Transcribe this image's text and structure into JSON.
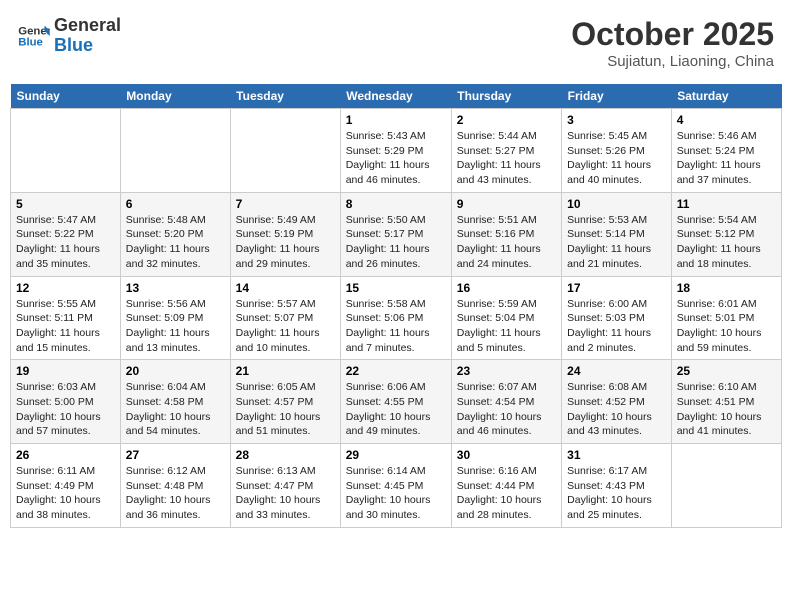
{
  "header": {
    "logo_general": "General",
    "logo_blue": "Blue",
    "month_title": "October 2025",
    "location": "Sujiatun, Liaoning, China"
  },
  "weekdays": [
    "Sunday",
    "Monday",
    "Tuesday",
    "Wednesday",
    "Thursday",
    "Friday",
    "Saturday"
  ],
  "days": [
    {
      "num": "",
      "info": ""
    },
    {
      "num": "",
      "info": ""
    },
    {
      "num": "",
      "info": ""
    },
    {
      "num": "1",
      "info": "Sunrise: 5:43 AM\nSunset: 5:29 PM\nDaylight: 11 hours and 46 minutes."
    },
    {
      "num": "2",
      "info": "Sunrise: 5:44 AM\nSunset: 5:27 PM\nDaylight: 11 hours and 43 minutes."
    },
    {
      "num": "3",
      "info": "Sunrise: 5:45 AM\nSunset: 5:26 PM\nDaylight: 11 hours and 40 minutes."
    },
    {
      "num": "4",
      "info": "Sunrise: 5:46 AM\nSunset: 5:24 PM\nDaylight: 11 hours and 37 minutes."
    },
    {
      "num": "5",
      "info": "Sunrise: 5:47 AM\nSunset: 5:22 PM\nDaylight: 11 hours and 35 minutes."
    },
    {
      "num": "6",
      "info": "Sunrise: 5:48 AM\nSunset: 5:20 PM\nDaylight: 11 hours and 32 minutes."
    },
    {
      "num": "7",
      "info": "Sunrise: 5:49 AM\nSunset: 5:19 PM\nDaylight: 11 hours and 29 minutes."
    },
    {
      "num": "8",
      "info": "Sunrise: 5:50 AM\nSunset: 5:17 PM\nDaylight: 11 hours and 26 minutes."
    },
    {
      "num": "9",
      "info": "Sunrise: 5:51 AM\nSunset: 5:16 PM\nDaylight: 11 hours and 24 minutes."
    },
    {
      "num": "10",
      "info": "Sunrise: 5:53 AM\nSunset: 5:14 PM\nDaylight: 11 hours and 21 minutes."
    },
    {
      "num": "11",
      "info": "Sunrise: 5:54 AM\nSunset: 5:12 PM\nDaylight: 11 hours and 18 minutes."
    },
    {
      "num": "12",
      "info": "Sunrise: 5:55 AM\nSunset: 5:11 PM\nDaylight: 11 hours and 15 minutes."
    },
    {
      "num": "13",
      "info": "Sunrise: 5:56 AM\nSunset: 5:09 PM\nDaylight: 11 hours and 13 minutes."
    },
    {
      "num": "14",
      "info": "Sunrise: 5:57 AM\nSunset: 5:07 PM\nDaylight: 11 hours and 10 minutes."
    },
    {
      "num": "15",
      "info": "Sunrise: 5:58 AM\nSunset: 5:06 PM\nDaylight: 11 hours and 7 minutes."
    },
    {
      "num": "16",
      "info": "Sunrise: 5:59 AM\nSunset: 5:04 PM\nDaylight: 11 hours and 5 minutes."
    },
    {
      "num": "17",
      "info": "Sunrise: 6:00 AM\nSunset: 5:03 PM\nDaylight: 11 hours and 2 minutes."
    },
    {
      "num": "18",
      "info": "Sunrise: 6:01 AM\nSunset: 5:01 PM\nDaylight: 10 hours and 59 minutes."
    },
    {
      "num": "19",
      "info": "Sunrise: 6:03 AM\nSunset: 5:00 PM\nDaylight: 10 hours and 57 minutes."
    },
    {
      "num": "20",
      "info": "Sunrise: 6:04 AM\nSunset: 4:58 PM\nDaylight: 10 hours and 54 minutes."
    },
    {
      "num": "21",
      "info": "Sunrise: 6:05 AM\nSunset: 4:57 PM\nDaylight: 10 hours and 51 minutes."
    },
    {
      "num": "22",
      "info": "Sunrise: 6:06 AM\nSunset: 4:55 PM\nDaylight: 10 hours and 49 minutes."
    },
    {
      "num": "23",
      "info": "Sunrise: 6:07 AM\nSunset: 4:54 PM\nDaylight: 10 hours and 46 minutes."
    },
    {
      "num": "24",
      "info": "Sunrise: 6:08 AM\nSunset: 4:52 PM\nDaylight: 10 hours and 43 minutes."
    },
    {
      "num": "25",
      "info": "Sunrise: 6:10 AM\nSunset: 4:51 PM\nDaylight: 10 hours and 41 minutes."
    },
    {
      "num": "26",
      "info": "Sunrise: 6:11 AM\nSunset: 4:49 PM\nDaylight: 10 hours and 38 minutes."
    },
    {
      "num": "27",
      "info": "Sunrise: 6:12 AM\nSunset: 4:48 PM\nDaylight: 10 hours and 36 minutes."
    },
    {
      "num": "28",
      "info": "Sunrise: 6:13 AM\nSunset: 4:47 PM\nDaylight: 10 hours and 33 minutes."
    },
    {
      "num": "29",
      "info": "Sunrise: 6:14 AM\nSunset: 4:45 PM\nDaylight: 10 hours and 30 minutes."
    },
    {
      "num": "30",
      "info": "Sunrise: 6:16 AM\nSunset: 4:44 PM\nDaylight: 10 hours and 28 minutes."
    },
    {
      "num": "31",
      "info": "Sunrise: 6:17 AM\nSunset: 4:43 PM\nDaylight: 10 hours and 25 minutes."
    },
    {
      "num": "",
      "info": ""
    }
  ]
}
